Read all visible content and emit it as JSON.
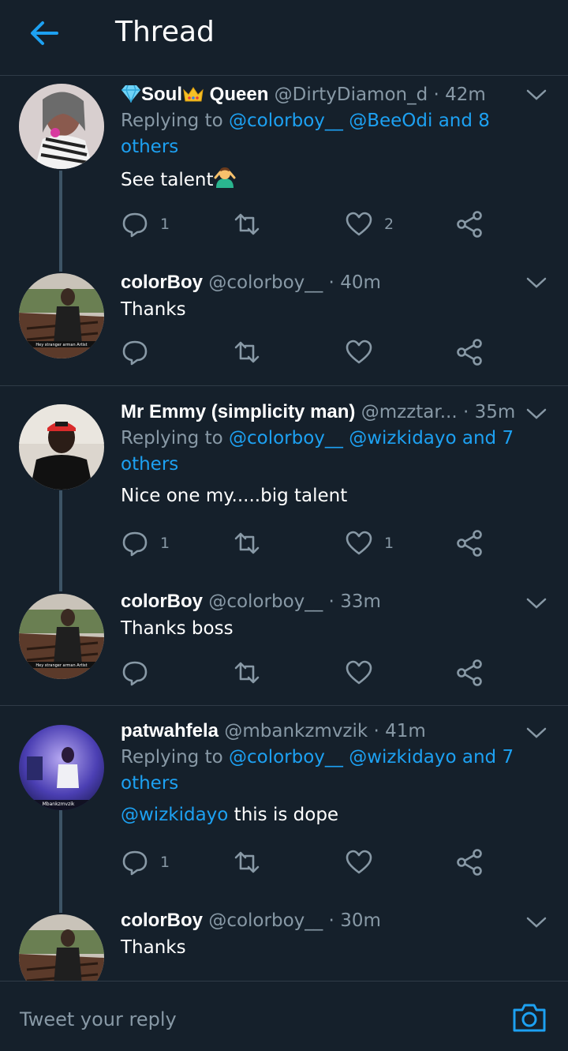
{
  "header": {
    "title": "Thread"
  },
  "colors": {
    "bg": "#15202b",
    "accent": "#1da1f2",
    "muted": "#8899a6",
    "divider": "#2f3b47"
  },
  "tweets": [
    {
      "display_name": "Soul Queen",
      "name_prefix_icon": "gem-emoji",
      "name_mid_icon": "crown-emoji",
      "name_part1": "Soul",
      "name_part2": " Queen",
      "handle": "@DirtyDiamon_d",
      "time": "42m",
      "replying_label": "Replying to ",
      "replying_users": "@colorboy__ @BeeOdi and 8 others",
      "text": "See talent",
      "text_icon": "person-gesturing-emoji",
      "reply_count": "1",
      "like_count": "2"
    },
    {
      "display_name": "colorBoy",
      "handle": "@colorboy__",
      "time": "40m",
      "text": "Thanks",
      "reply_count": "",
      "like_count": ""
    },
    {
      "display_name": "Mr Emmy (simplicity man)",
      "handle": "@mzztar...",
      "time": "35m",
      "replying_label": "Replying to ",
      "replying_users": "@colorboy__ @wizkidayo and 7 others",
      "text": "Nice one my.....big talent",
      "reply_count": "1",
      "like_count": "1"
    },
    {
      "display_name": "colorBoy",
      "handle": "@colorboy__",
      "time": "33m",
      "text": "Thanks boss",
      "reply_count": "",
      "like_count": ""
    },
    {
      "display_name": "patwahfela",
      "handle": "@mbankzmvzik",
      "time": "41m",
      "replying_label": "Replying to ",
      "replying_users": "@colorboy__ @wizkidayo and 7 others",
      "text_mention": "@wizkidayo",
      "text": " this is dope",
      "reply_count": "1",
      "like_count": ""
    },
    {
      "display_name": "colorBoy",
      "handle": "@colorboy__",
      "time": "30m",
      "text": "Thanks"
    }
  ],
  "composer": {
    "placeholder": "Tweet your reply"
  }
}
